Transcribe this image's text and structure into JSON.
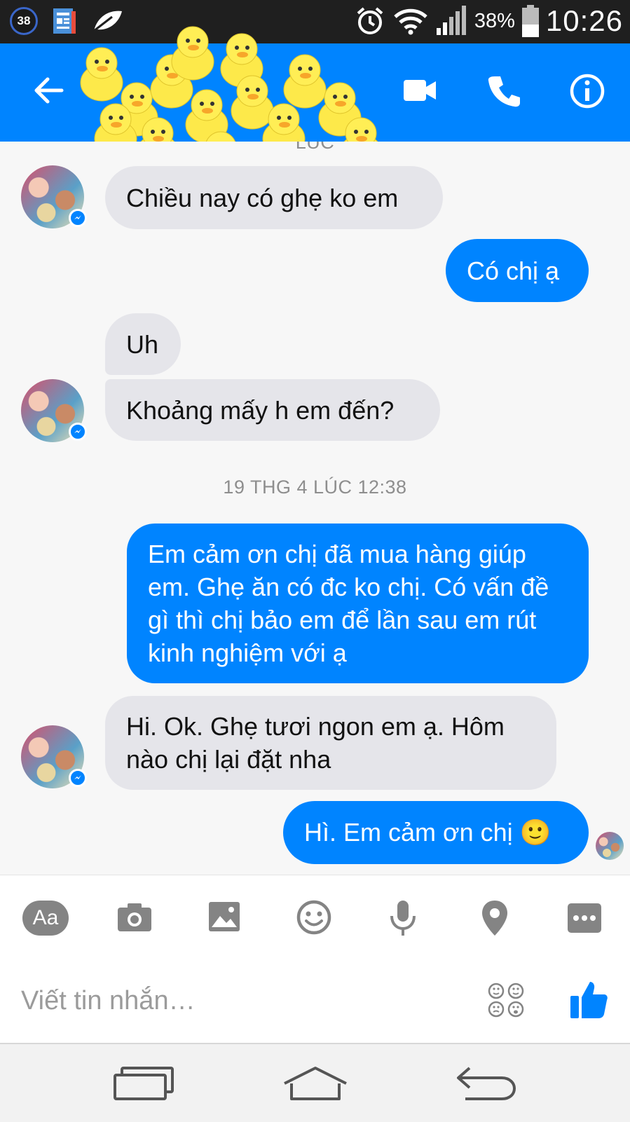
{
  "status_bar": {
    "notification_count": "38",
    "battery_percent": "38%",
    "time": "10:26"
  },
  "conversation": {
    "partial_timestamp": "LÚC",
    "timestamp_2": "19 THG 4 LÚC 12:38",
    "messages": [
      {
        "from": "contact",
        "text": "Chiều nay có ghẹ ko em"
      },
      {
        "from": "me",
        "text": "Có chị ạ"
      },
      {
        "from": "contact",
        "text": "Uh"
      },
      {
        "from": "contact",
        "text": "Khoảng mấy h em đến?"
      },
      {
        "from": "me",
        "text": "Em cảm ơn chị đã mua hàng giúp em. Ghẹ ăn có đc ko chị. Có vấn đề gì thì chị bảo em để lần sau em rút kinh nghiệm với ạ"
      },
      {
        "from": "contact",
        "text": "Hi. Ok. Ghẹ tươi ngon em ạ. Hôm nào chị lại đặt nha"
      },
      {
        "from": "me",
        "text": "Hì. Em cảm ơn chị 🙂"
      }
    ]
  },
  "composer": {
    "aa_label": "Aa",
    "placeholder": "Viết tin nhắn…"
  },
  "colors": {
    "accent": "#0084ff",
    "incoming_bubble": "#e5e5ea",
    "status_bar": "#1f1f1f"
  }
}
